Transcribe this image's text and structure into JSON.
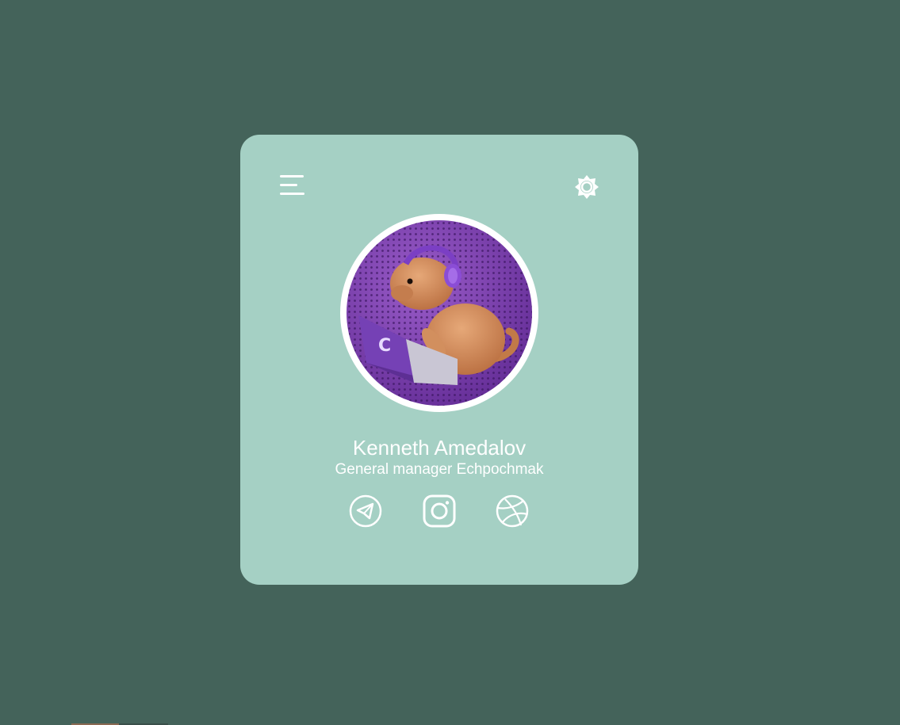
{
  "profile": {
    "name": "Kenneth Amedalov",
    "role": "General manager Echpochmak",
    "avatar_alt": "Capybara with headphones using a laptop"
  },
  "toolbar": {
    "menu_icon": "hamburger-menu-icon",
    "theme_icon": "brightness-icon"
  },
  "socials": [
    {
      "name": "telegram",
      "icon": "telegram-icon"
    },
    {
      "name": "instagram",
      "icon": "instagram-icon"
    },
    {
      "name": "dribbble",
      "icon": "dribbble-icon"
    }
  ],
  "colors": {
    "background": "#44635a",
    "card": "#a5d0c4",
    "foreground": "#ffffff",
    "avatar_bg": "#7a3fb0"
  }
}
